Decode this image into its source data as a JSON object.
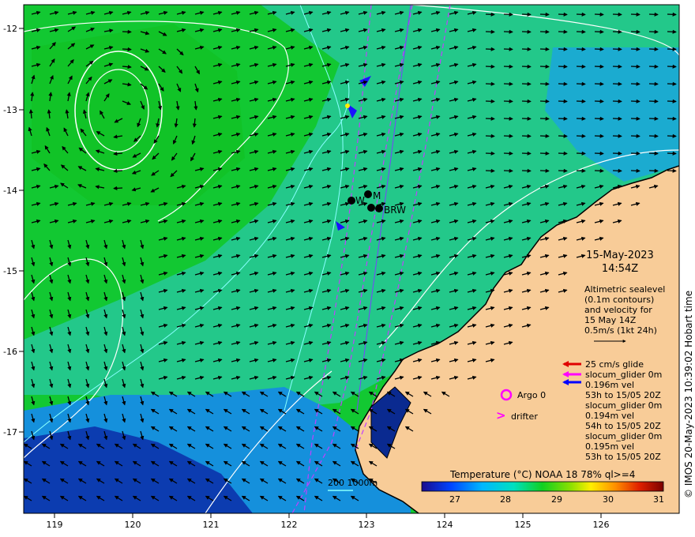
{
  "map": {
    "date": "15-May-2023",
    "time": "14:54Z",
    "copyright": "© IMOS 20-May-2023 10:39:02 Hobart time",
    "x_ticks": [
      "119",
      "120",
      "121",
      "122",
      "123",
      "124",
      "125",
      "126"
    ],
    "y_ticks": [
      "-12",
      "-13",
      "-14",
      "-15",
      "-16",
      "-17"
    ],
    "altimetry_lines": [
      "Altimetric sealevel",
      "(0.1m contours)",
      "and velocity for",
      "15 May 14Z",
      "0.5m/s (1kt 24h)"
    ],
    "legend": {
      "glide_label": "25 cm/s glide",
      "items": [
        {
          "name": "slocum_glider 0m",
          "detail": [
            "0.196m vel",
            "53h to 15/05 20Z"
          ],
          "color": "#ff00ff"
        },
        {
          "name": "slocum_glider 0m",
          "detail": [
            "0.194m vel",
            "54h to 15/05 20Z"
          ],
          "color": "#0000ff"
        },
        {
          "name": "slocum_glider 0m",
          "detail": [
            "0.195m vel",
            "53h to 15/05 20Z"
          ],
          "color": "#000000"
        }
      ],
      "argo_label": "Argo 0",
      "drifter_label": "drifter",
      "drifter_symbol": ">"
    },
    "colorbar": {
      "title": "Temperature (°C) NOAA 18 78% ql>=4",
      "ticks": [
        "27",
        "28",
        "29",
        "30",
        "31"
      ]
    },
    "isobath_label": "200  1000m",
    "stations": [
      "W",
      "M",
      "BRW"
    ]
  }
}
